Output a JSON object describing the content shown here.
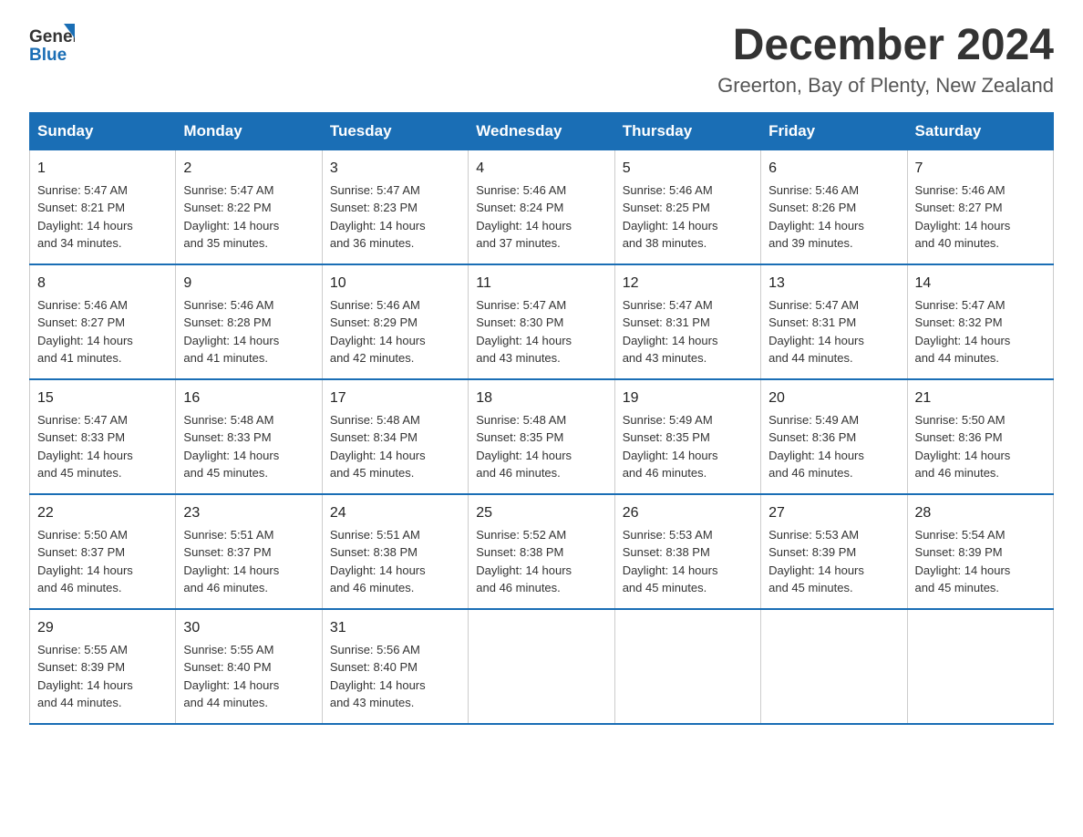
{
  "logo": {
    "general": "General",
    "blue": "Blue"
  },
  "header": {
    "title": "December 2024",
    "subtitle": "Greerton, Bay of Plenty, New Zealand"
  },
  "days_of_week": [
    "Sunday",
    "Monday",
    "Tuesday",
    "Wednesday",
    "Thursday",
    "Friday",
    "Saturday"
  ],
  "weeks": [
    [
      {
        "day": "1",
        "sunrise": "5:47 AM",
        "sunset": "8:21 PM",
        "daylight": "14 hours and 34 minutes."
      },
      {
        "day": "2",
        "sunrise": "5:47 AM",
        "sunset": "8:22 PM",
        "daylight": "14 hours and 35 minutes."
      },
      {
        "day": "3",
        "sunrise": "5:47 AM",
        "sunset": "8:23 PM",
        "daylight": "14 hours and 36 minutes."
      },
      {
        "day": "4",
        "sunrise": "5:46 AM",
        "sunset": "8:24 PM",
        "daylight": "14 hours and 37 minutes."
      },
      {
        "day": "5",
        "sunrise": "5:46 AM",
        "sunset": "8:25 PM",
        "daylight": "14 hours and 38 minutes."
      },
      {
        "day": "6",
        "sunrise": "5:46 AM",
        "sunset": "8:26 PM",
        "daylight": "14 hours and 39 minutes."
      },
      {
        "day": "7",
        "sunrise": "5:46 AM",
        "sunset": "8:27 PM",
        "daylight": "14 hours and 40 minutes."
      }
    ],
    [
      {
        "day": "8",
        "sunrise": "5:46 AM",
        "sunset": "8:27 PM",
        "daylight": "14 hours and 41 minutes."
      },
      {
        "day": "9",
        "sunrise": "5:46 AM",
        "sunset": "8:28 PM",
        "daylight": "14 hours and 41 minutes."
      },
      {
        "day": "10",
        "sunrise": "5:46 AM",
        "sunset": "8:29 PM",
        "daylight": "14 hours and 42 minutes."
      },
      {
        "day": "11",
        "sunrise": "5:47 AM",
        "sunset": "8:30 PM",
        "daylight": "14 hours and 43 minutes."
      },
      {
        "day": "12",
        "sunrise": "5:47 AM",
        "sunset": "8:31 PM",
        "daylight": "14 hours and 43 minutes."
      },
      {
        "day": "13",
        "sunrise": "5:47 AM",
        "sunset": "8:31 PM",
        "daylight": "14 hours and 44 minutes."
      },
      {
        "day": "14",
        "sunrise": "5:47 AM",
        "sunset": "8:32 PM",
        "daylight": "14 hours and 44 minutes."
      }
    ],
    [
      {
        "day": "15",
        "sunrise": "5:47 AM",
        "sunset": "8:33 PM",
        "daylight": "14 hours and 45 minutes."
      },
      {
        "day": "16",
        "sunrise": "5:48 AM",
        "sunset": "8:33 PM",
        "daylight": "14 hours and 45 minutes."
      },
      {
        "day": "17",
        "sunrise": "5:48 AM",
        "sunset": "8:34 PM",
        "daylight": "14 hours and 45 minutes."
      },
      {
        "day": "18",
        "sunrise": "5:48 AM",
        "sunset": "8:35 PM",
        "daylight": "14 hours and 46 minutes."
      },
      {
        "day": "19",
        "sunrise": "5:49 AM",
        "sunset": "8:35 PM",
        "daylight": "14 hours and 46 minutes."
      },
      {
        "day": "20",
        "sunrise": "5:49 AM",
        "sunset": "8:36 PM",
        "daylight": "14 hours and 46 minutes."
      },
      {
        "day": "21",
        "sunrise": "5:50 AM",
        "sunset": "8:36 PM",
        "daylight": "14 hours and 46 minutes."
      }
    ],
    [
      {
        "day": "22",
        "sunrise": "5:50 AM",
        "sunset": "8:37 PM",
        "daylight": "14 hours and 46 minutes."
      },
      {
        "day": "23",
        "sunrise": "5:51 AM",
        "sunset": "8:37 PM",
        "daylight": "14 hours and 46 minutes."
      },
      {
        "day": "24",
        "sunrise": "5:51 AM",
        "sunset": "8:38 PM",
        "daylight": "14 hours and 46 minutes."
      },
      {
        "day": "25",
        "sunrise": "5:52 AM",
        "sunset": "8:38 PM",
        "daylight": "14 hours and 46 minutes."
      },
      {
        "day": "26",
        "sunrise": "5:53 AM",
        "sunset": "8:38 PM",
        "daylight": "14 hours and 45 minutes."
      },
      {
        "day": "27",
        "sunrise": "5:53 AM",
        "sunset": "8:39 PM",
        "daylight": "14 hours and 45 minutes."
      },
      {
        "day": "28",
        "sunrise": "5:54 AM",
        "sunset": "8:39 PM",
        "daylight": "14 hours and 45 minutes."
      }
    ],
    [
      {
        "day": "29",
        "sunrise": "5:55 AM",
        "sunset": "8:39 PM",
        "daylight": "14 hours and 44 minutes."
      },
      {
        "day": "30",
        "sunrise": "5:55 AM",
        "sunset": "8:40 PM",
        "daylight": "14 hours and 44 minutes."
      },
      {
        "day": "31",
        "sunrise": "5:56 AM",
        "sunset": "8:40 PM",
        "daylight": "14 hours and 43 minutes."
      },
      null,
      null,
      null,
      null
    ]
  ],
  "colors": {
    "header_bg": "#1a6eb5",
    "header_text": "#ffffff",
    "border": "#1a6eb5",
    "cell_border": "#cccccc"
  },
  "labels": {
    "sunrise": "Sunrise:",
    "sunset": "Sunset:",
    "daylight": "Daylight:"
  }
}
